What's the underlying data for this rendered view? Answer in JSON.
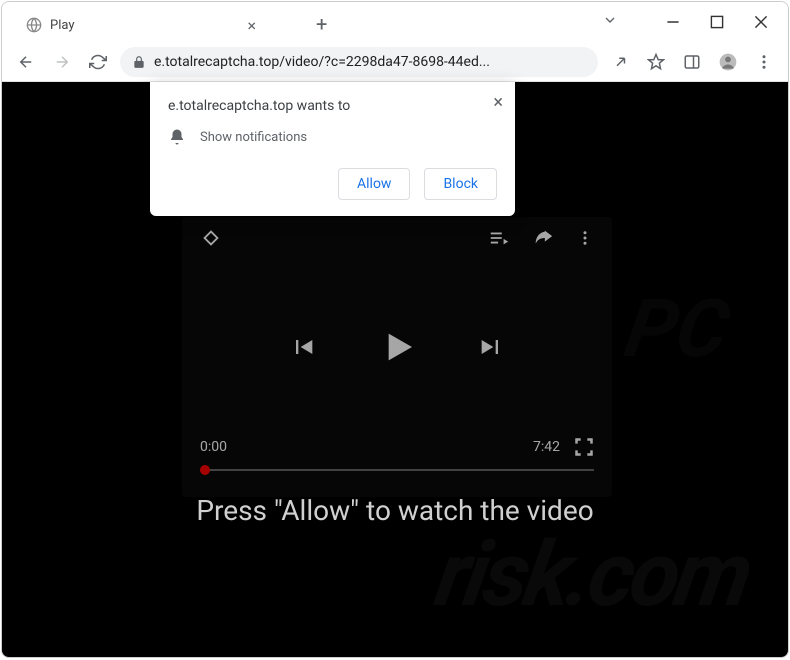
{
  "window": {
    "tab_title": "Play"
  },
  "toolbar": {
    "url": "e.totalrecaptcha.top/video/?c=2298da47-8698-44ed..."
  },
  "notification": {
    "title": "e.totalrecaptcha.top wants to",
    "body": "Show notifications",
    "allow_label": "Allow",
    "block_label": "Block"
  },
  "video": {
    "current_time": "0:00",
    "duration": "7:42"
  },
  "page": {
    "caption": "Press \"Allow\" to watch the video"
  },
  "colors": {
    "accent": "#1a73e8",
    "progress": "#ff0000"
  },
  "watermark": "risk.com",
  "watermark2": "PC"
}
